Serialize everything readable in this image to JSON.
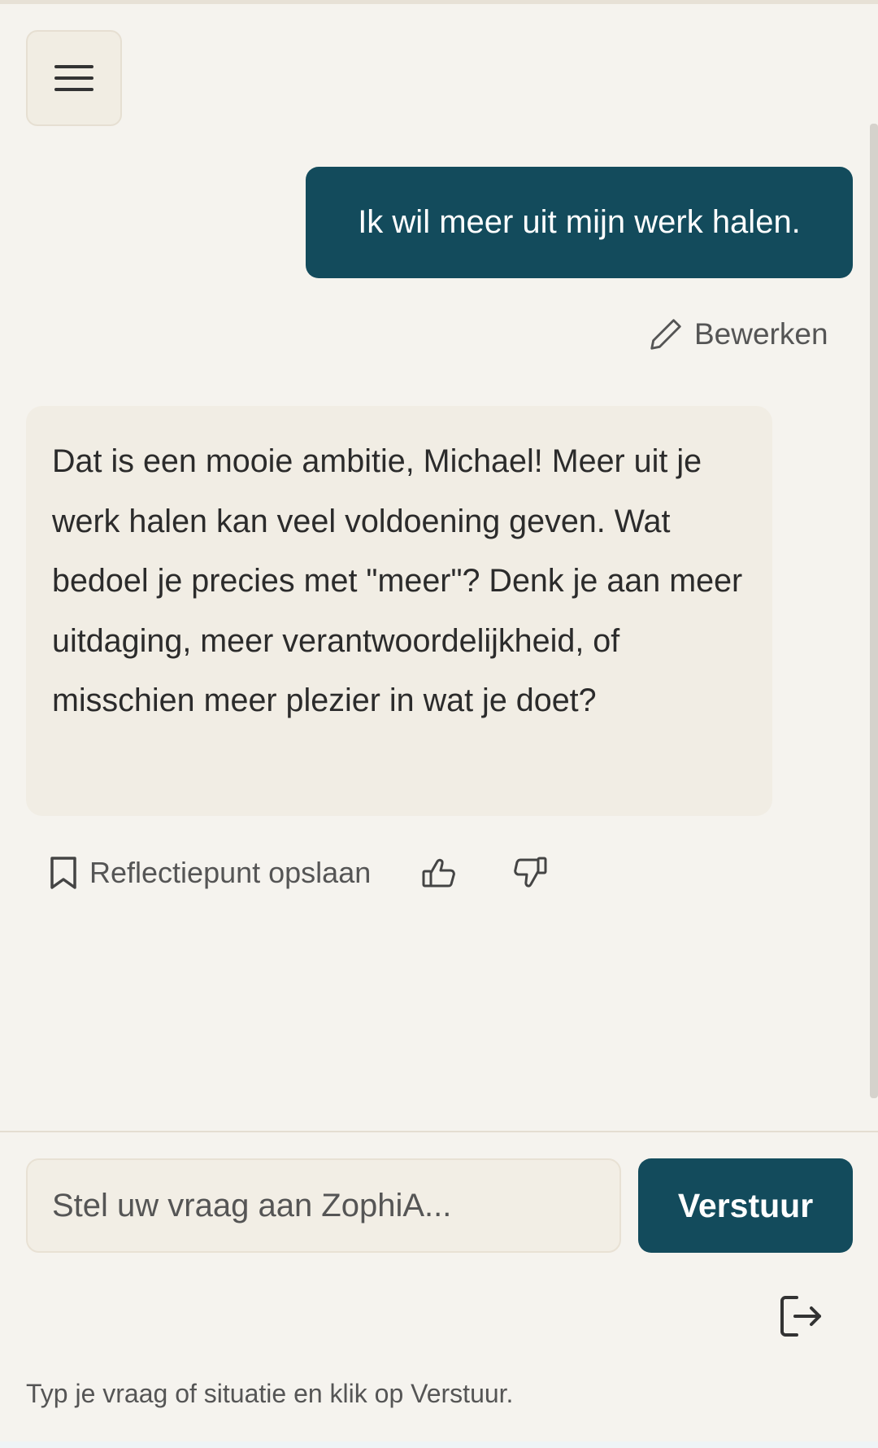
{
  "header": {
    "menu_icon": "hamburger-menu-icon"
  },
  "conversation": {
    "user_message": "Ik wil meer uit mijn werk halen.",
    "edit_label": "Bewerken",
    "assistant_message": "Dat is een mooie ambitie, Michael! Meer uit je werk halen kan veel voldoening geven. Wat bedoel je precies met \"meer\"? Denk je aan meer uitdaging, meer verantwoordelijkheid, of misschien meer plezier in wat je doet?",
    "save_label": "Reflectiepunt opslaan"
  },
  "composer": {
    "placeholder": "Stel uw vraag aan ZophiA...",
    "send_label": "Verstuur",
    "hint": "Typ je vraag of situatie en klik op Verstuur."
  },
  "colors": {
    "accent": "#134b5c",
    "background": "#f5f3ee",
    "bubble": "#f1ede4"
  }
}
